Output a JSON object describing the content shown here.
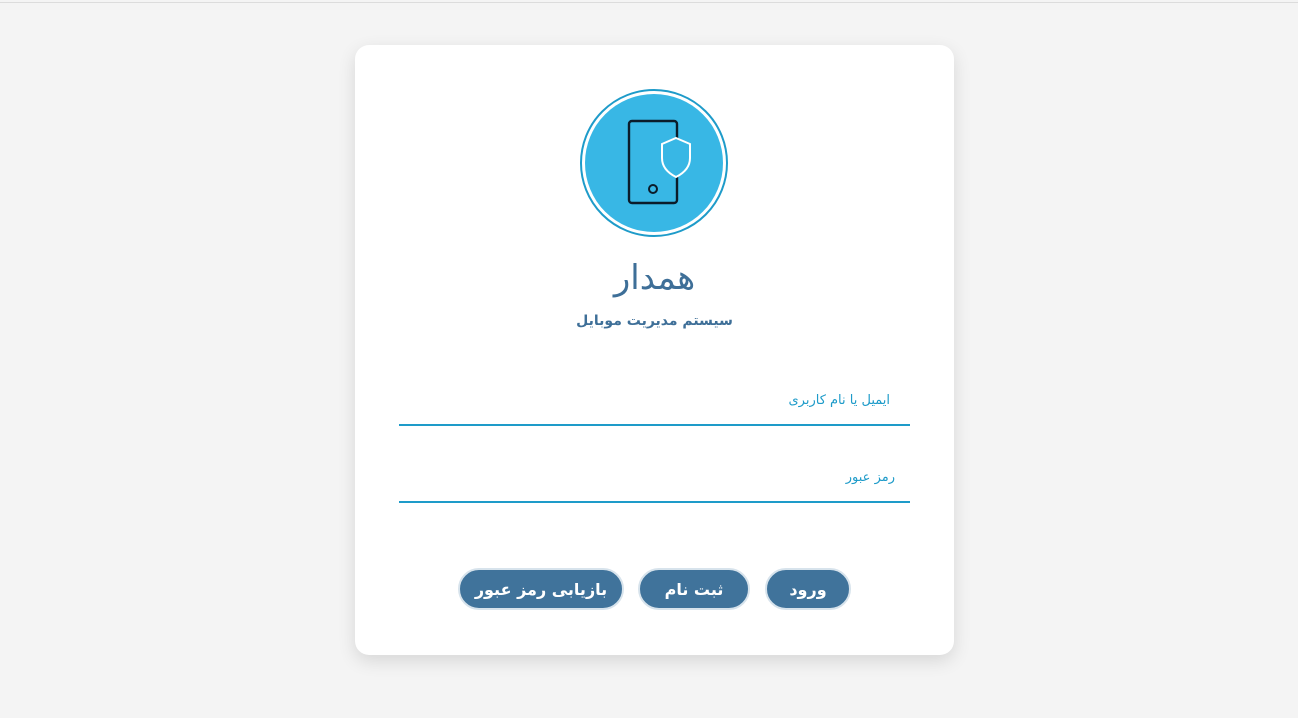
{
  "brand": {
    "title": "همدار",
    "subtitle": "سیستم مدیریت موبایل",
    "logo_icon": "mobile-shield-icon",
    "colors": {
      "accent": "#1e9bc9",
      "logo_bg": "#38b7e5",
      "button": "#40739b",
      "title": "#3e6f98"
    }
  },
  "form": {
    "email_label": "ایمیل یا نام کاربری",
    "password_label": "رمز عبور"
  },
  "buttons": {
    "login": "ورود",
    "register": "ثبت نام",
    "recover": "بازیابی رمز عبور"
  }
}
